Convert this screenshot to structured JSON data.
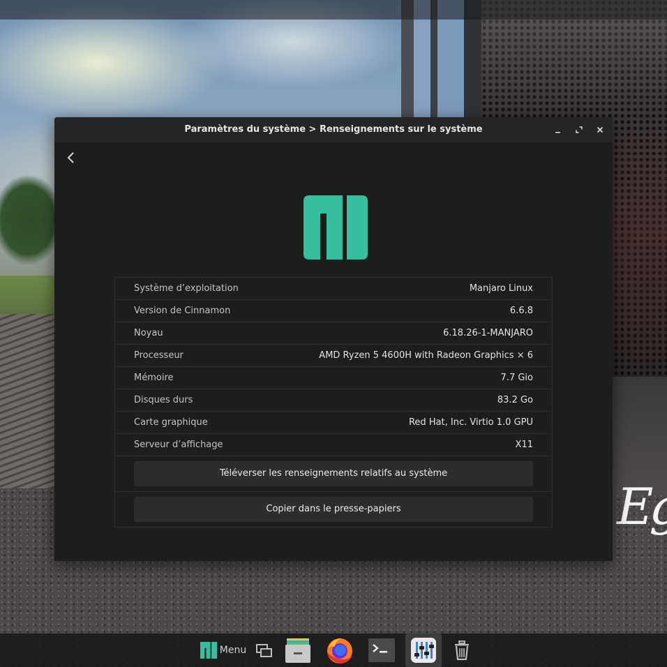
{
  "window": {
    "title": "Paramètres du système > Renseignements sur le système",
    "controls": {
      "minimize": "_",
      "maximize": "⤢",
      "close": "✕"
    }
  },
  "logo": {
    "name": "manjaro-logo",
    "color": "#35bf9f"
  },
  "system_info": {
    "rows": [
      {
        "label": "Système d’exploitation",
        "value": "Manjaro Linux"
      },
      {
        "label": "Version de Cinnamon",
        "value": "6.6.8"
      },
      {
        "label": "Noyau",
        "value": "6.18.26-1-MANJARO"
      },
      {
        "label": "Processeur",
        "value": "AMD Ryzen 5 4600H with Radeon Graphics × 6"
      },
      {
        "label": "Mémoire",
        "value": "7.7 Gio"
      },
      {
        "label": "Disques durs",
        "value": "83.2 Go"
      },
      {
        "label": "Carte graphique",
        "value": "Red Hat, Inc. Virtio 1.0 GPU"
      },
      {
        "label": "Serveur d’affichage",
        "value": "X11"
      }
    ],
    "upload_button": "Téléverser les renseignements relatifs au système",
    "copy_button": "Copier dans le presse-papiers"
  },
  "taskbar": {
    "menu_label": "Menu",
    "items": [
      "manjaro-menu-icon",
      "window-switcher-icon",
      "file-manager-icon",
      "firefox-icon",
      "terminal-icon",
      "system-settings-icon",
      "trash-icon"
    ]
  },
  "colors": {
    "accent": "#35bf9f",
    "window_bg": "#1d1d1d",
    "button_bg": "#2d2d2d"
  }
}
